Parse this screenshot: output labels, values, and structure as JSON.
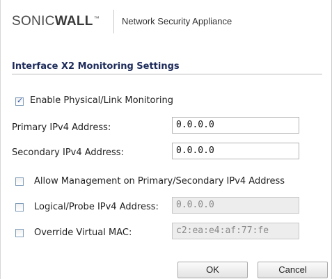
{
  "header": {
    "brand_part1": "SONIC",
    "brand_part2": "WALL",
    "trademark": "™",
    "product": "Network Security Appliance"
  },
  "section": {
    "title": "Interface X2 Monitoring Settings"
  },
  "form": {
    "enable_monitoring": {
      "label": "Enable Physical/Link Monitoring",
      "checked": true
    },
    "primary_ipv4": {
      "label": "Primary IPv4 Address:",
      "value": "0.0.0.0"
    },
    "secondary_ipv4": {
      "label": "Secondary IPv4 Address:",
      "value": "0.0.0.0"
    },
    "allow_management": {
      "label": "Allow Management on Primary/Secondary IPv4 Address",
      "checked": false
    },
    "logical_probe": {
      "label": "Logical/Probe IPv4 Address:",
      "value": "0.0.0.0",
      "checked": false
    },
    "override_mac": {
      "label": "Override Virtual MAC:",
      "value": "c2:ea:e4:af:77:fe",
      "checked": false
    }
  },
  "buttons": {
    "ok": "OK",
    "cancel": "Cancel"
  }
}
